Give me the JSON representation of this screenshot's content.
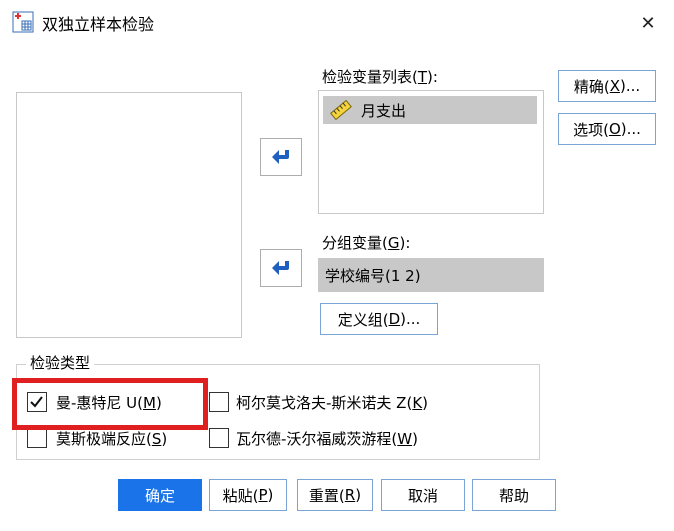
{
  "window": {
    "title": "双独立样本检验",
    "close_glyph": "✕"
  },
  "test_vars": {
    "label": "检验变量列表(T):",
    "label_pre": "检验变量列表(",
    "label_key": "T",
    "label_post": "):",
    "items": [
      "月支出"
    ]
  },
  "grouping": {
    "label_pre": "分组变量(",
    "label_key": "G",
    "label_post": "):",
    "value": "学校编号(1 2)"
  },
  "define_groups": {
    "pre": "定义组(",
    "key": "D",
    "post": ")..."
  },
  "side_buttons": {
    "exact": {
      "pre": "精确(",
      "key": "X",
      "post": ")..."
    },
    "options": {
      "pre": "选项(",
      "key": "O",
      "post": ")..."
    }
  },
  "test_type": {
    "title": "检验类型",
    "mann_whitney": {
      "pre": "曼-惠特尼 U(",
      "key": "M",
      "post": ")",
      "checked": true
    },
    "ks": {
      "pre": "柯尔莫戈洛夫-斯米诺夫 Z(",
      "key": "K",
      "post": ")",
      "checked": false
    },
    "moses": {
      "pre": "莫斯极端反应(",
      "key": "S",
      "post": ")",
      "checked": false
    },
    "wald": {
      "pre": "瓦尔德-沃尔福威茨游程(",
      "key": "W",
      "post": ")",
      "checked": false
    }
  },
  "bottom_buttons": {
    "ok": "确定",
    "paste": {
      "pre": "粘贴(",
      "key": "P",
      "post": ")"
    },
    "reset": {
      "pre": "重置(",
      "key": "R",
      "post": ")"
    },
    "cancel": "取消",
    "help": "帮助"
  },
  "colors": {
    "primary": "#1a73e8",
    "highlight": "#e02020",
    "selection": "#c8c8c8"
  }
}
